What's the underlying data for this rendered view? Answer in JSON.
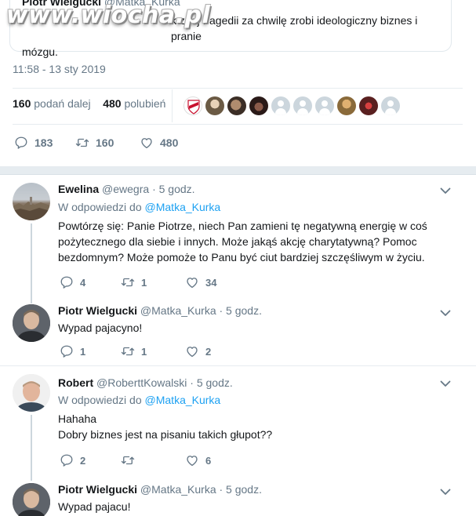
{
  "quoted": {
    "author_name": "Piotr Wielgucki",
    "author_handle": "@Matka_Kurka",
    "text_line1": "k z tej tragedii za chwilę zrobi ideologiczny biznes i pranie",
    "text_line2": "mózgu."
  },
  "watermark": "www.wiocha.pl",
  "timestamp": "11:58 - 13 sty 2019",
  "stats": {
    "retweets_count": "160",
    "retweets_label": "podań dalej",
    "likes_count": "480",
    "likes_label": "polubień"
  },
  "actions": {
    "replies": "183",
    "retweets": "160",
    "likes": "480"
  },
  "replies": [
    {
      "name": "Ewelina",
      "handle": "@ewegra",
      "time": "· 5 godz.",
      "reply_to_prefix": "W odpowiedzi do",
      "reply_to": "@Matka_Kurka",
      "lines": [
        "Powtórzę się: Panie Piotrze, niech Pan zamieni tę negatywną energię w coś",
        "pożytecznego dla siebie i innych. Może jakąś akcję charytatywną? Pomoc",
        "bezdomnym? Może pomoże to Panu być ciut bardziej szczęśliwym w życiu."
      ],
      "reply_count": "4",
      "retweet_count": "1",
      "like_count": "34"
    },
    {
      "name": "Piotr Wielgucki",
      "handle": "@Matka_Kurka",
      "time": "· 5 godz.",
      "lines": [
        "Wypad pajacyno!"
      ],
      "reply_count": "1",
      "retweet_count": "1",
      "like_count": "2"
    },
    {
      "name": "Robert",
      "handle": "@RoberttKowalski",
      "time": "· 5 godz.",
      "reply_to_prefix": "W odpowiedzi do",
      "reply_to": "@Matka_Kurka",
      "lines": [
        "Hahaha",
        "Dobry biznes jest na pisaniu takich głupot??"
      ],
      "reply_count": "2",
      "retweet_count": "",
      "like_count": "6"
    },
    {
      "name": "Piotr Wielgucki",
      "handle": "@Matka_Kurka",
      "time": "· 5 godz.",
      "lines": [
        "Wypad pajacu!"
      ]
    }
  ],
  "icons": {
    "reply": "reply-icon",
    "retweet": "retweet-icon",
    "like": "heart-icon",
    "more": "chevron-down-icon"
  },
  "colors": {
    "link": "#1da1f2",
    "muted": "#657786",
    "text": "#14171a",
    "divider": "#e6ecf0"
  }
}
